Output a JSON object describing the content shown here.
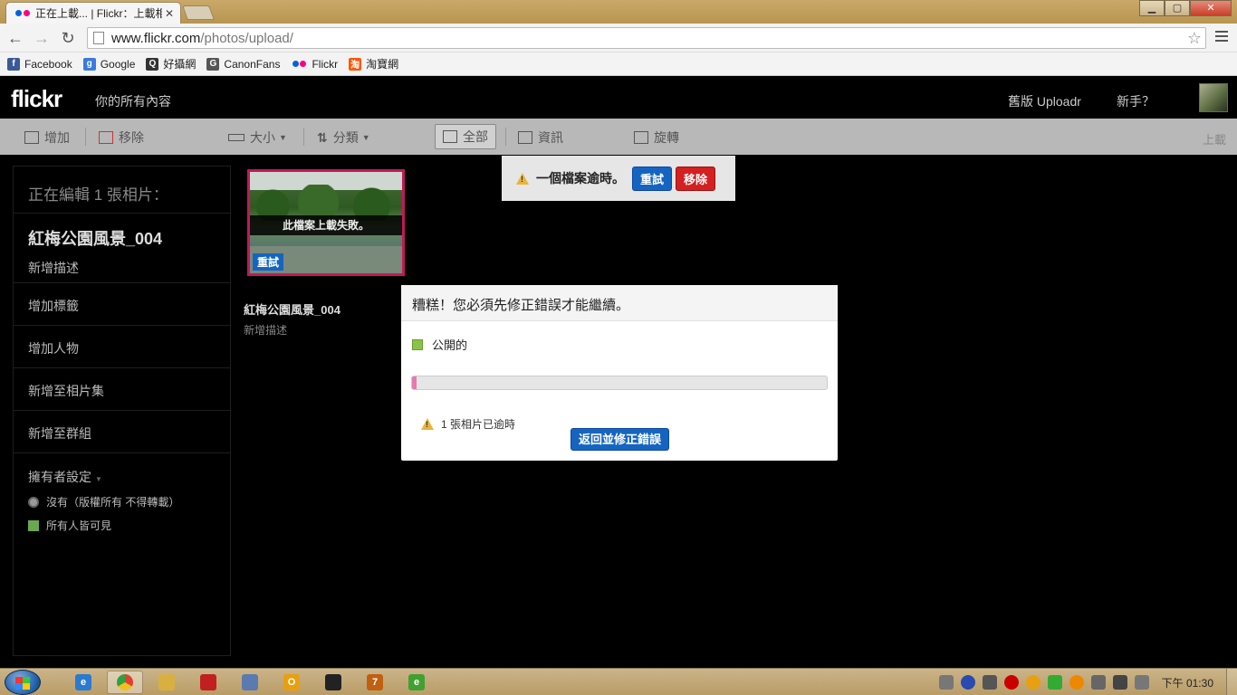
{
  "browser": {
    "tab_title": "正在上載... | Flickr：上載相",
    "tab_close": "✕",
    "url_host": "www.flickr.com",
    "url_path": "/photos/upload/",
    "window_controls": {
      "minimize": "▁",
      "maximize": "▢",
      "close": "✕"
    }
  },
  "bookmarks": [
    {
      "label": "Facebook",
      "icon": "facebook-icon",
      "color": "#3b5998",
      "glyph": "f"
    },
    {
      "label": "Google",
      "icon": "google-icon",
      "color": "#3a7ae0",
      "glyph": "g"
    },
    {
      "label": "好攝網",
      "icon": "camera-site-icon",
      "color": "#333333",
      "glyph": "Q"
    },
    {
      "label": "CanonFans",
      "icon": "canonfans-icon",
      "color": "#555555",
      "glyph": "G"
    },
    {
      "label": "Flickr",
      "icon": "flickr-icon",
      "color": "#ffffff",
      "glyph": ""
    },
    {
      "label": "淘寶網",
      "icon": "taobao-icon",
      "color": "#ff5500",
      "glyph": "淘"
    }
  ],
  "header": {
    "logo": "flickr",
    "your_content": "你的所有內容",
    "old_uploadr": "舊版 Uploadr",
    "new_user": "新手？"
  },
  "editbar": {
    "add": "增加",
    "remove": "移除",
    "size": "大小",
    "sort": "分類",
    "all": "全部",
    "info": "資訊",
    "rotate": "旋轉",
    "upload": "上載"
  },
  "notice": {
    "message": "一個檔案逾時。",
    "retry": "重試",
    "remove": "移除"
  },
  "sidebar": {
    "heading": "正在編輯 1 張相片：",
    "photo_title": "紅梅公園風景_004",
    "add_description": "新增描述",
    "add_tags": "增加標籤",
    "add_people": "增加人物",
    "add_to_set": "新增至相片集",
    "add_to_group": "新增至群組",
    "owner_settings": "擁有者設定",
    "license": "沒有（版權所有 不得轉載）",
    "visibility": "所有人皆可見"
  },
  "tile": {
    "fail_banner": "此檔案上載失敗。",
    "retry": "重試",
    "title": "紅梅公園風景_004",
    "description": "新增描述"
  },
  "modal": {
    "title": "糟糕！您必須先修正錯誤才能繼續。",
    "privacy": "公開的",
    "progress_percent": 1,
    "warning": "1 張相片已逾時",
    "button": "返回並修正錯誤"
  },
  "taskbar": {
    "time": "下午 01:30",
    "apps": [
      {
        "name": "ie-icon",
        "color": "#2a7ad0",
        "glyph": "e",
        "active": false
      },
      {
        "name": "chrome-icon",
        "color": "#e04030",
        "glyph": "",
        "active": true
      },
      {
        "name": "folder-icon",
        "color": "#d8b040",
        "glyph": "",
        "active": false
      },
      {
        "name": "pdf-icon",
        "color": "#c02020",
        "glyph": "",
        "active": false
      },
      {
        "name": "photo-viewer-icon",
        "color": "#5a7ab0",
        "glyph": "",
        "active": false
      },
      {
        "name": "outlook-icon",
        "color": "#e8a010",
        "glyph": "O",
        "active": false
      },
      {
        "name": "camera-app-icon",
        "color": "#222222",
        "glyph": "",
        "active": false
      },
      {
        "name": "app-7-icon",
        "color": "#c06010",
        "glyph": "7",
        "active": false
      },
      {
        "name": "app-green-icon",
        "color": "#40a030",
        "glyph": "e",
        "active": false
      }
    ]
  }
}
